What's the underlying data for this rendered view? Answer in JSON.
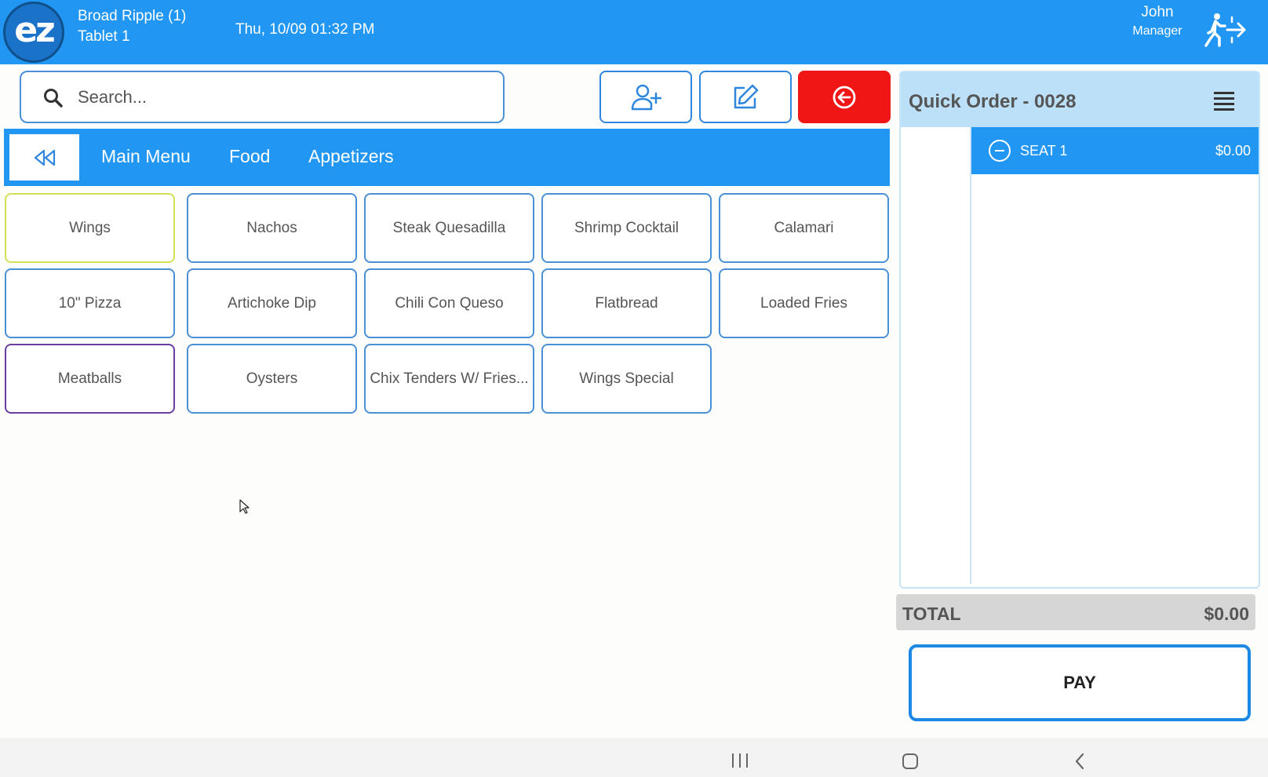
{
  "header": {
    "location": "Broad Ripple (1)",
    "device": "Tablet 1",
    "datetime": "Thu, 10/09 01:32 PM",
    "user_name": "John",
    "user_role": "Manager",
    "logo_text": "ez",
    "bg_color": "#2196f3"
  },
  "search": {
    "placeholder": "Search...",
    "value": ""
  },
  "toolbar": {
    "add_customer_icon": "user-plus-icon",
    "edit_icon": "edit-icon",
    "exit_icon": "arrow-left-circle-icon",
    "exit_color": "#f01616"
  },
  "breadcrumb": {
    "back_icon": "rewind-icon",
    "items": [
      "Main Menu",
      "Food",
      "Appetizers"
    ]
  },
  "menu_items": [
    {
      "label": "Wings",
      "border": "#d4e157"
    },
    {
      "label": "Nachos",
      "border": "#4a90d6"
    },
    {
      "label": "Steak Quesadilla",
      "border": "#4a90d6"
    },
    {
      "label": "Shrimp Cocktail",
      "border": "#4a90d6"
    },
    {
      "label": "Calamari",
      "border": "#4a90d6"
    },
    {
      "label": "10\" Pizza",
      "border": "#4a90d6"
    },
    {
      "label": "Artichoke Dip",
      "border": "#4a90d6"
    },
    {
      "label": "Chili Con Queso",
      "border": "#4a90d6"
    },
    {
      "label": "Flatbread",
      "border": "#4a90d6"
    },
    {
      "label": "Loaded Fries",
      "border": "#4a90d6"
    },
    {
      "label": "Meatballs",
      "border": "#6a3ea1"
    },
    {
      "label": "Oysters",
      "border": "#4a90d6"
    },
    {
      "label": "Chix Tenders W/ Fries...",
      "border": "#4a90d6"
    },
    {
      "label": "Wings Special",
      "border": "#4a90d6"
    }
  ],
  "order": {
    "title": "Quick Order - 0028",
    "seat_label": "SEAT 1",
    "seat_amount": "$0.00",
    "total_label": "TOTAL",
    "total_amount": "$0.00",
    "pay_label": "PAY"
  }
}
